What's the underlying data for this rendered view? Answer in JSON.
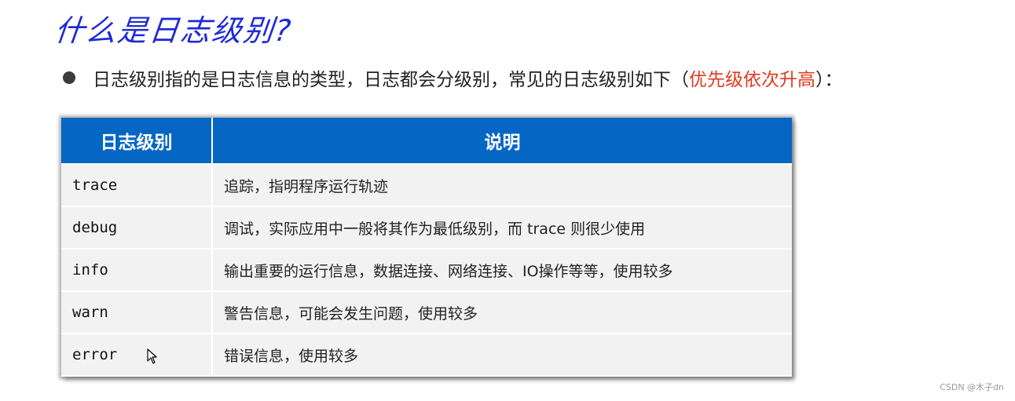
{
  "title": "什么是日志级别?",
  "bullet": {
    "text": "日志级别指的是日志信息的类型，日志都会分级别，常见的日志级别如下（",
    "highlight": "优先级依次升高",
    "suffix": "）："
  },
  "table": {
    "headers": [
      "日志级别",
      "说明"
    ],
    "rows": [
      {
        "level": "trace",
        "desc": "追踪，指明程序运行轨迹"
      },
      {
        "level": "debug",
        "desc": "调试，实际应用中一般将其作为最低级别，而 trace 则很少使用"
      },
      {
        "level": "info",
        "desc": "输出重要的运行信息，数据连接、网络连接、IO操作等等，使用较多"
      },
      {
        "level": "warn",
        "desc": "警告信息，可能会发生问题，使用较多"
      },
      {
        "level": "error",
        "desc": "错误信息，使用较多"
      }
    ]
  },
  "watermark": "CSDN @木子dn",
  "colors": {
    "title": "#1f2bd6",
    "header_bg": "#0566c4",
    "highlight": "#e03a1e",
    "cell_bg": "#f2f2f2"
  }
}
